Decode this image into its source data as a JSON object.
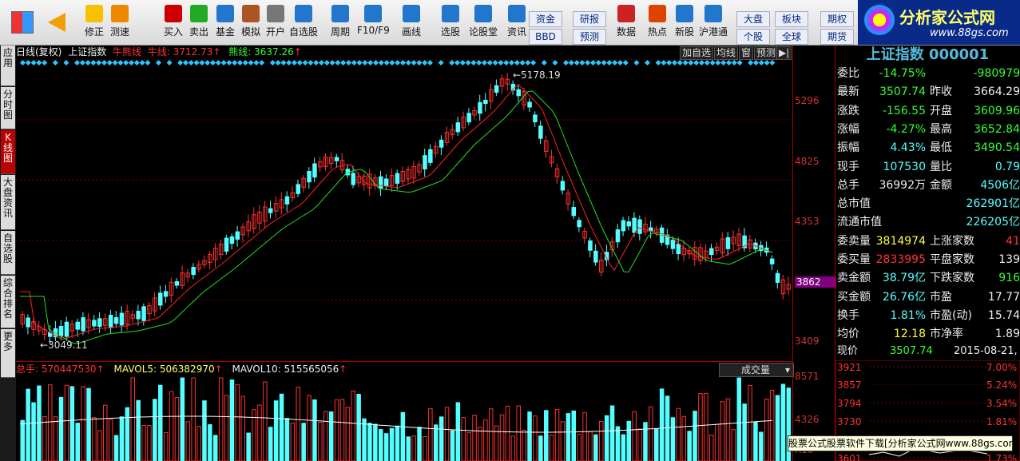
{
  "toolbar": {
    "buttons": [
      {
        "label": "修正",
        "icon": "up-down-arrows-icon"
      },
      {
        "label": "测速",
        "icon": "speed-icon"
      },
      {
        "label": "买入",
        "icon": "buy-icon"
      },
      {
        "label": "卖出",
        "icon": "sell-icon"
      },
      {
        "label": "基金",
        "icon": "fund-icon"
      },
      {
        "label": "模拟",
        "icon": "hammer-icon"
      },
      {
        "label": "开户",
        "icon": "lock-icon"
      },
      {
        "label": "自选股",
        "icon": "star-icon"
      },
      {
        "label": "周期",
        "icon": "clock-icon"
      },
      {
        "label": "F10/F9",
        "icon": "f10-icon"
      },
      {
        "label": "画线",
        "icon": "pencil-icon"
      },
      {
        "label": "选股",
        "icon": "screen-icon"
      },
      {
        "label": "论股堂",
        "icon": "forum-icon"
      },
      {
        "label": "资讯",
        "icon": "news-icon"
      },
      {
        "label": "数据",
        "icon": "pe-icon"
      },
      {
        "label": "热点",
        "icon": "hot-icon"
      },
      {
        "label": "新股",
        "icon": "new-stock-icon"
      },
      {
        "label": "沪港通",
        "icon": "hk-connect-icon"
      }
    ],
    "small": [
      "资金",
      "BBD",
      "研报",
      "预测",
      "大盘",
      "个股",
      "板块",
      "全球",
      "期权",
      "期货"
    ],
    "top_buy": "买",
    "top_sell": "卖",
    "top_ce": "论",
    "pe": "PE",
    "hot": "热"
  },
  "logo": {
    "title": "分析家公式网",
    "url": "www.88gs.com"
  },
  "left_tabs": [
    "应用",
    "分时图",
    "K线图",
    "大盘资讯",
    "自选股",
    "综合排名",
    "更多"
  ],
  "chart": {
    "header": {
      "period": "日线(复权)",
      "name": "上证指数",
      "bull_label": "牛熊线",
      "bull_name": "牛线:",
      "bull_val": "3712.73",
      "bear_name": "熊线:",
      "bear_val": "3637.26"
    },
    "view_buttons": [
      "加自选",
      "均线",
      "窗",
      "预测"
    ],
    "price_axis": [
      "5296",
      "4825",
      "4353",
      "3862",
      "3409"
    ],
    "current_price_label": "3862",
    "high_label": "5178.19",
    "low_label": "3049.11"
  },
  "volume": {
    "header": {
      "label": "总手: 570447530",
      "mav5": "MAVOL5: 506382970",
      "mav10": "MAVOL10: 515565056"
    },
    "dropdown": "成交量",
    "axis": [
      "8571",
      "4326",
      "X10"
    ]
  },
  "quote": {
    "title": "上证指数 000001",
    "rows": [
      {
        "l1": "委比",
        "v1": "-14.75%",
        "c1": "green",
        "l2": "",
        "v2": "-980979",
        "c2": "green"
      },
      {
        "l1": "最新",
        "v1": "3507.74",
        "c1": "green",
        "l2": "昨收",
        "v2": "3664.29",
        "c2": "white"
      },
      {
        "l1": "涨跌",
        "v1": "-156.55",
        "c1": "green",
        "l2": "开盘",
        "v2": "3609.96",
        "c2": "green"
      },
      {
        "l1": "涨幅",
        "v1": "-4.27%",
        "c1": "green",
        "l2": "最高",
        "v2": "3652.84",
        "c2": "green"
      },
      {
        "l1": "振幅",
        "v1": "4.43%",
        "c1": "cyan",
        "l2": "最低",
        "v2": "3490.54",
        "c2": "green"
      },
      {
        "l1": "现手",
        "v1": "107530",
        "c1": "cyan",
        "l2": "量比",
        "v2": "0.79",
        "c2": "cyan"
      },
      {
        "l1": "总手",
        "v1": "36992万",
        "c1": "white",
        "l2": "金额",
        "v2": "4506亿",
        "c2": "cyan"
      },
      {
        "l1": "总市值",
        "v1": "",
        "c1": "white",
        "l2": "",
        "v2": "262901亿",
        "c2": "cyan"
      },
      {
        "l1": "流通市值",
        "v1": "",
        "c1": "white",
        "l2": "",
        "v2": "226205亿",
        "c2": "cyan"
      },
      {
        "l1": "委卖量",
        "v1": "3814974",
        "c1": "yellow",
        "l2": "上涨家数",
        "v2": "41",
        "c2": "red"
      },
      {
        "l1": "委买量",
        "v1": "2833995",
        "c1": "red",
        "l2": "平盘家数",
        "v2": "139",
        "c2": "white"
      },
      {
        "l1": "卖金额",
        "v1": "38.79亿",
        "c1": "cyan",
        "l2": "下跌家数",
        "v2": "916",
        "c2": "green"
      },
      {
        "l1": "买金额",
        "v1": "26.76亿",
        "c1": "cyan",
        "l2": "市盈",
        "v2": "17.77",
        "c2": "white"
      },
      {
        "l1": "换手",
        "v1": "1.81%",
        "c1": "cyan",
        "l2": "市盈(动)",
        "v2": "15.74",
        "c2": "white"
      },
      {
        "l1": "均价",
        "v1": "12.18",
        "c1": "yellow",
        "l2": "市净率",
        "v2": "1.89",
        "c2": "white"
      }
    ],
    "now_label": "现价",
    "now_val": "3507.74",
    "date": "2015-08-21,五",
    "mini_axis": [
      "3921",
      "3857",
      "3794",
      "3730",
      "3601"
    ],
    "mini_pct": [
      "7.00%",
      "5.24%",
      "3.54%",
      "1.81%",
      "1.73%"
    ]
  },
  "footer": "股票公式股票软件下载[分析家公式网www.88gs.com]",
  "colors": {
    "up": "#ff3030",
    "down": "#54ffff",
    "ma_red": "#ff2020",
    "ma_green": "#22dd22"
  }
}
